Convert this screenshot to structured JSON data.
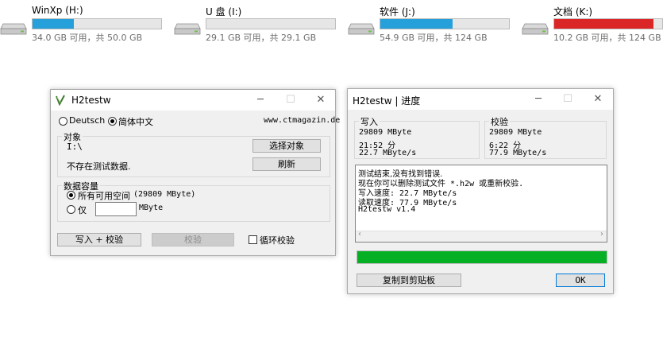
{
  "drives": [
    {
      "name": "WinXp (H:)",
      "size": "34.0 GB 可用，共 50.0 GB",
      "used_fraction": 0.32,
      "color": "#26a0da"
    },
    {
      "name": "U 盘 (I:)",
      "size": "29.1 GB 可用，共 29.1 GB",
      "used_fraction": 0.0,
      "color": "#26a0da"
    },
    {
      "name": "软件 (J:)",
      "size": "54.9 GB 可用，共 124 GB",
      "used_fraction": 0.56,
      "color": "#26a0da"
    },
    {
      "name": "文档 (K:)",
      "size": "10.2 GB 可用，共 124 GB",
      "used_fraction": 0.92,
      "color": "#da2626"
    }
  ],
  "main_window": {
    "title": "H2testw",
    "lang_de": "Deutsch",
    "lang_zh": "简体中文",
    "website": "www.ctmagazin.de",
    "target_label": "对象",
    "target_path": "I:\\",
    "select_button": "选择对象",
    "no_data": "不存在测试数据.",
    "refresh_button": "刷新",
    "capacity_label": "数据容量",
    "all_space": "所有可用空间",
    "all_space_value": "(29809 MByte)",
    "only_label": "仅",
    "only_unit": "MByte",
    "write_verify_button": "写入 + 校验",
    "verify_button": "校验",
    "loop_verify": "循环校验"
  },
  "progress_window": {
    "title": "H2testw | 进度",
    "write_label": "写入",
    "write_size": "29809 MByte",
    "write_time": "21:52 分",
    "write_speed": "22.7 MByte/s",
    "verify_label": "校验",
    "verify_size": "29809 MByte",
    "verify_time": "6:22 分",
    "verify_speed": "77.9 MByte/s",
    "log_lines": [
      "测试结束,没有找到错误.",
      "现在你可以删除测试文件 *.h2w 或重新校验.",
      "写入速度: 22.7 MByte/s",
      "读取速度: 77.9 MByte/s",
      "H2testw v1.4"
    ],
    "progress_fraction": 1.0,
    "progress_color": "#06b025",
    "copy_button": "复制到剪贴板",
    "ok_button": "OK"
  }
}
